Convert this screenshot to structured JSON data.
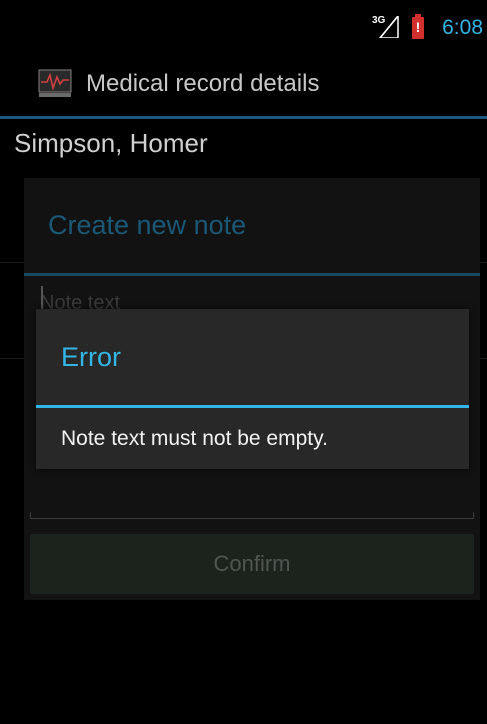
{
  "status_bar": {
    "network": "3G",
    "battery_alert": "!",
    "time": "6:08",
    "accent_color": "#33b5e5",
    "battery_color": "#d32f2f",
    "icons": [
      "signal-icon",
      "battery-icon"
    ]
  },
  "action_bar": {
    "title": "Medical record details",
    "icon": "medical-chart-icon"
  },
  "patient": {
    "name": "Simpson, Homer"
  },
  "create_dialog": {
    "title": "Create new note",
    "note_placeholder": "Note text",
    "note_value": "",
    "confirm_label": "Confirm"
  },
  "error_dialog": {
    "title": "Error",
    "message": "Note text must not be empty."
  }
}
